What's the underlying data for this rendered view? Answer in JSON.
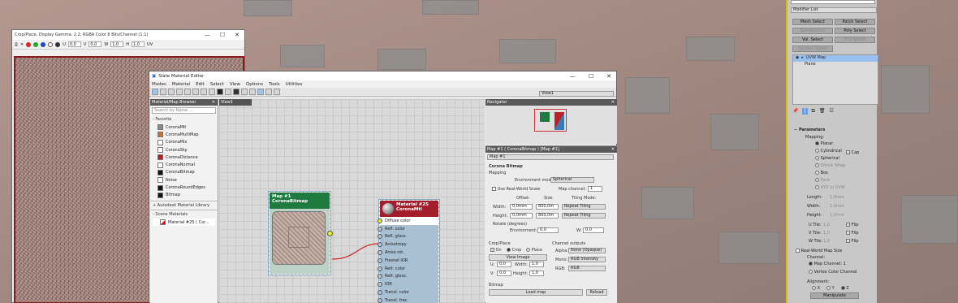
{
  "crop_window": {
    "title": "Crop/Place, Display Gamma: 2.2, RGBA Color 8 Bits/Channel (1:1)",
    "controls": {
      "minimize": "—",
      "maximize": "☐",
      "close": "✕"
    },
    "toolbar": {
      "u_label": "U",
      "u_value": "0,0",
      "v_label": "V",
      "v_value": "0,0",
      "w_label": "W",
      "w_value": "1,0",
      "h_label": "H",
      "h_value": "1,0",
      "uv": "UV"
    }
  },
  "slate": {
    "title": "Slate Material Editor",
    "controls": {
      "minimize": "—",
      "maximize": "☐",
      "close": "✕"
    },
    "menu": [
      "Modes",
      "Material",
      "Edit",
      "Select",
      "View",
      "Options",
      "Tools",
      "Utilities"
    ],
    "view_dropdown": "View1",
    "browser": {
      "title": "Material/Map Browser",
      "search": "Search by Name ...",
      "favorite_group": "- Favorite",
      "items": [
        {
          "label": "CoronaMtl",
          "color": "#888888"
        },
        {
          "label": "CoronaMultiMap",
          "color": "#d07020"
        },
        {
          "label": "CoronaMix",
          "color": "#ffffff"
        },
        {
          "label": "CoronaSky",
          "color": "#ffffff"
        },
        {
          "label": "CoronaDistance",
          "color": "#cc1111"
        },
        {
          "label": "CoronaNormal",
          "color": "#ffffff"
        },
        {
          "label": "CoronaBitmap",
          "color": "#111111"
        },
        {
          "label": "Noise",
          "color": "#ffffff"
        },
        {
          "label": "CoronaRoundEdges",
          "color": "#111111"
        },
        {
          "label": "Bitmap",
          "color": "#111111"
        }
      ],
      "autodesk_group": "+ Autodesk Material Library",
      "scene_group": "- Scene Materials",
      "scene_item": "Material #25  ( Cor..."
    },
    "view_tab": "View1",
    "navigator": "Navigator",
    "params": {
      "header": "Map #1 ( CoronaBitmap ) [Map #1]",
      "map_name": "Map #1",
      "rollout": "Corona Bitmap",
      "mapping": "Mapping",
      "env_mode_label": "Environment mode:",
      "env_mode_value": "Spherical",
      "use_real_world": "Use Real-World Scale",
      "map_channel_label": "Map channel:",
      "map_channel_value": "1",
      "offset_label": "Offset:",
      "size_label": "Size:",
      "tiling_label": "Tiling Mode:",
      "width_label": "Width:",
      "width_offset": "0,0mm",
      "width_size": "800,0m",
      "width_tiling": "Repeat Tiling",
      "height_label": "Height:",
      "height_offset": "0,0mm",
      "height_size": "800,0m",
      "height_tiling": "Repeat Tiling",
      "rotate_label": "Rotate (degrees)",
      "env_label": "Environment:",
      "env_u": "0,0",
      "env_v_label": "W:",
      "env_v": "0,0",
      "crop_label": "Crop/Place",
      "on": "On",
      "crop": "Crop",
      "place": "Place",
      "view_image": "View Image",
      "u_label": "U:",
      "u_val": "0,0",
      "cw_label": "Width:",
      "cw_val": "1,0",
      "v_label": "V:",
      "v_val": "0,0",
      "ch_label": "Height:",
      "ch_val": "1,0",
      "channel_outputs": "Channel outputs",
      "alpha_label": "Alpha:",
      "alpha_val": "None (Opaque)",
      "mono_label": "Mono:",
      "mono_val": "RGB Intensity",
      "rgb_label": "RGB:",
      "rgb_val": "RGB",
      "bitmap_label": "Bitmap",
      "load_map": "Load map",
      "reload": "Reload"
    },
    "nodes": {
      "bitmap": {
        "title": "Map #1",
        "subtitle": "CoronaBitmap"
      },
      "material": {
        "title": "Material #25",
        "subtitle": "CoronaMtl",
        "slots": [
          "Diffuse color",
          "Refl. color",
          "Refl. gloss.",
          "Anisotropy",
          "Aniso rot.",
          "Fresnel IOR",
          "Refr. color",
          "Refr. gloss.",
          "IOR",
          "Transl. color",
          "Transl. frac."
        ]
      }
    }
  },
  "modifier_panel": {
    "modifier_list": "Modifier List",
    "buttons": [
      "Mesh Select",
      "Patch Select",
      "SplineSelect",
      "Poly Select",
      "Vol. Select",
      "FFD Select",
      "Surface Select"
    ],
    "stack": [
      "UVW Map",
      "Plane"
    ],
    "params_title": "Parameters",
    "mapping": "Mapping:",
    "mapping_options": [
      "Planar",
      "Cylindrical",
      "Spherical",
      "Shrink Wrap",
      "Box",
      "Face",
      "XYZ to UVW"
    ],
    "cap": "Cap",
    "length_label": "Length:",
    "length": "1,0mm",
    "width_label": "Width:",
    "width": "1,0mm",
    "height_label": "Height:",
    "height": "1,0mm",
    "utile_label": "U Tile:",
    "utile": "1,0",
    "vtile_label": "V Tile:",
    "vtile": "1,0",
    "wtile_label": "W Tile:",
    "wtile": "1,0",
    "flip": "Flip",
    "real_world": "Real-World Map Size",
    "channel": "Channel:",
    "map_channel": "Map Channel:",
    "map_channel_val": "1",
    "vertex_channel": "Vertex Color Channel",
    "alignment": "Alignment:",
    "x": "X",
    "y": "Y",
    "z": "Z",
    "manipulate": "Manipulate"
  }
}
